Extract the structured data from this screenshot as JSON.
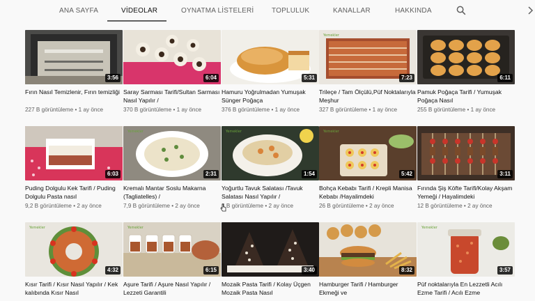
{
  "tabs": [
    {
      "label": "ANA SAYFA"
    },
    {
      "label": "VİDEOLAR"
    },
    {
      "label": "OYNATMA LİSTELERİ"
    },
    {
      "label": "TOPLULUK"
    },
    {
      "label": "KANALLAR"
    },
    {
      "label": "HAKKINDA"
    }
  ],
  "icons": {
    "search": "search-icon",
    "next": "chevron-right-icon"
  },
  "videos": [
    {
      "title": "Fırın Nasıl Temizlenir, Fırın temizliği",
      "duration": "3:56",
      "views": "227 B görüntüleme",
      "age": "1 ay önce"
    },
    {
      "title": "Saray Sarması Tarifi/Sultan Sarması Nasıl Yapılır /",
      "duration": "6:04",
      "views": "370 B görüntüleme",
      "age": "1 ay önce"
    },
    {
      "title": "Hamuru Yoğrulmadan Yumuşak Sünger Poğaça",
      "duration": "5:31",
      "views": "376 B görüntüleme",
      "age": "1 ay önce"
    },
    {
      "title": "Trileçe / Tam Ölçülü,Püf Noktalarıyla Meşhur",
      "duration": "7:23",
      "views": "327 B görüntüleme",
      "age": "1 ay önce"
    },
    {
      "title": "Pamuk Poğaça Tarifi / Yumuşak Poğaça Nasıl",
      "duration": "6:11",
      "views": "255 B görüntüleme",
      "age": "1 ay önce"
    },
    {
      "title": "Puding Dolgulu Kek Tarifi / Puding Dolgulu Pasta nasıl",
      "duration": "6:03",
      "views": "9,2 B görüntüleme",
      "age": "2 ay önce"
    },
    {
      "title": "Kremalı Mantar Soslu Makarna (Tagliatelles) /",
      "duration": "2:31",
      "views": "7,9 B görüntüleme",
      "age": "2 ay önce"
    },
    {
      "title": "Yoğurtlu Tavuk Salatası /Tavuk Salatası Nasıl Yapılır /",
      "duration": "1:54",
      "views": "3 B görüntüleme",
      "age": "2 ay önce"
    },
    {
      "title": "Bohça Kebabı Tarifi / Krepli Manisa Kebabı /Hayalimdeki",
      "duration": "5:42",
      "views": "26 B görüntüleme",
      "age": "2 ay önce"
    },
    {
      "title": "Fırında Şiş Köfte Tarifi/Kolay Akşam Yemeği / Hayalimdeki",
      "duration": "3:11",
      "views": "12 B görüntüleme",
      "age": "2 ay önce"
    },
    {
      "title": "Kısır Tarifi / Kısır Nasıl Yapılır / Kek kalıbında Kısır Nasıl",
      "duration": "4:32",
      "views": "",
      "age": ""
    },
    {
      "title": "Aşure Tarifi / Aşure Nasıl Yapılır / Lezzeti Garantili",
      "duration": "6:15",
      "views": "",
      "age": ""
    },
    {
      "title": "Mozaik Pasta Tarifi / Kolay Üçgen Mozaik Pasta Nasıl",
      "duration": "3:40",
      "views": "",
      "age": ""
    },
    {
      "title": "Hamburger Tarifi / Hamburger Ekmeği ve",
      "duration": "8:32",
      "views": "",
      "age": ""
    },
    {
      "title": "Püf noktalarıyla En Lezzetli Acılı Ezme Tarifi / Acılı Ezme",
      "duration": "3:57",
      "views": "",
      "age": ""
    }
  ]
}
